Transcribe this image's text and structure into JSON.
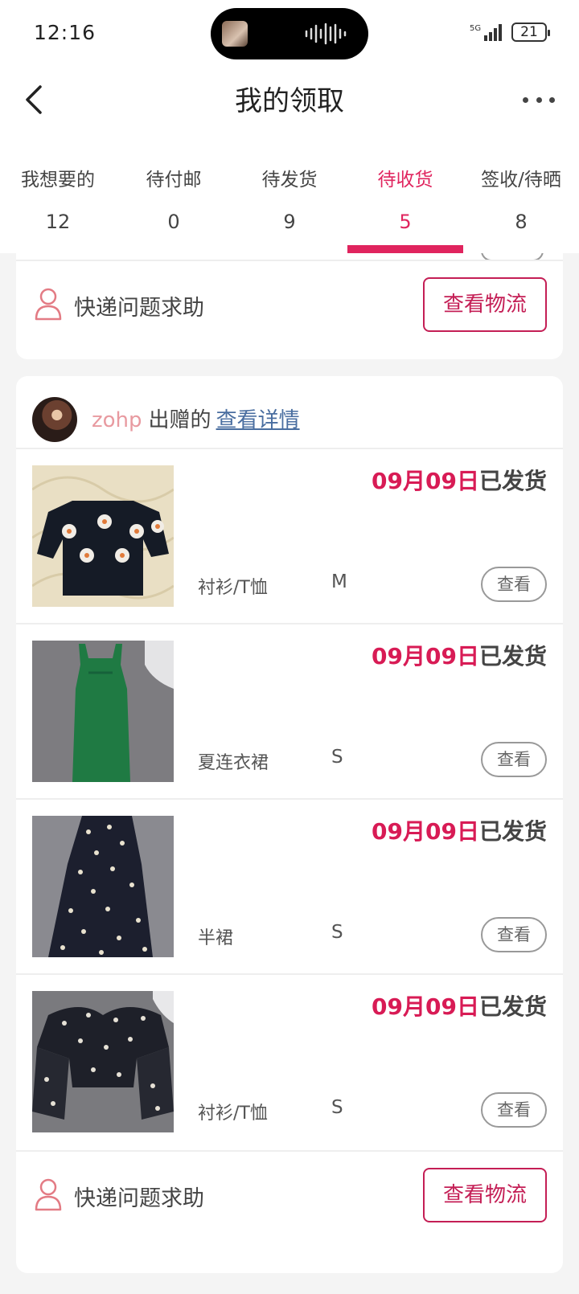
{
  "status_bar": {
    "time": "12:16",
    "network": "5G",
    "battery": "21"
  },
  "header": {
    "title": "我的领取"
  },
  "tabs": [
    {
      "label": "我想要的",
      "count": "12"
    },
    {
      "label": "待付邮",
      "count": "0"
    },
    {
      "label": "待发货",
      "count": "9"
    },
    {
      "label": "待收货",
      "count": "5",
      "active": true
    },
    {
      "label": "签收/待晒",
      "count": "8"
    }
  ],
  "top_card": {
    "help_label": "快递问题求助",
    "logistics_label": "查看物流"
  },
  "order": {
    "giver": {
      "name": "zohp",
      "action": "出赠的",
      "detail_link": "查看详情"
    },
    "items": [
      {
        "date": "09月09日",
        "status": "已发货",
        "category": "衬衫/T恤",
        "size": "M",
        "view_label": "查看"
      },
      {
        "date": "09月09日",
        "status": "已发货",
        "category": "夏连衣裙",
        "size": "S",
        "view_label": "查看"
      },
      {
        "date": "09月09日",
        "status": "已发货",
        "category": "半裙",
        "size": "S",
        "view_label": "查看"
      },
      {
        "date": "09月09日",
        "status": "已发货",
        "category": "衬衫/T恤",
        "size": "S",
        "view_label": "查看"
      }
    ],
    "help_label": "快递问题求助",
    "logistics_label": "查看物流"
  },
  "colors": {
    "accent": "#e0245e",
    "link": "#4a6ea0",
    "giver_name": "#e89aa0"
  }
}
